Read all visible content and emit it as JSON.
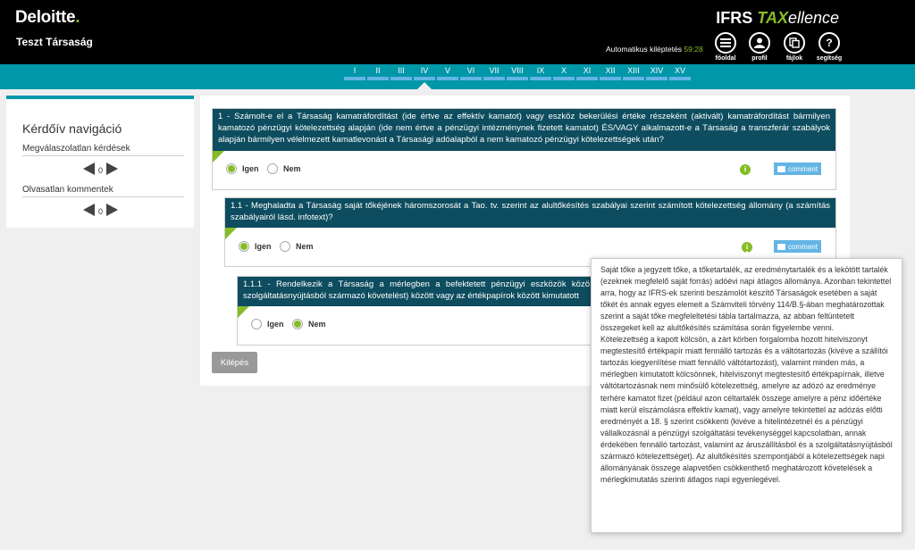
{
  "header": {
    "logo": "Deloitte",
    "logo_dot": ".",
    "company": "Teszt Társaság",
    "brand_ifrs": "IFRS ",
    "brand_tax": "TAX",
    "brand_ellence": "ellence",
    "logout_label": "Automatikus kiléptetés",
    "logout_time": "59:28",
    "buttons": [
      {
        "label": "főoldal",
        "icon": "menu-icon"
      },
      {
        "label": "profil",
        "icon": "user-icon"
      },
      {
        "label": "fájlok",
        "icon": "files-icon"
      },
      {
        "label": "segítség",
        "icon": "help-icon"
      }
    ]
  },
  "roman_nav": [
    "I",
    "II",
    "III",
    "IV",
    "V",
    "VI",
    "VII",
    "VIII",
    "IX",
    "X",
    "XI",
    "XII",
    "XIII",
    "XIV",
    "XV"
  ],
  "active_roman": "IV",
  "sidebar": {
    "title": "Kérdőív navigáció",
    "unanswered_label": "Megválaszolatlan kérdések",
    "unanswered_count": "0",
    "unread_label": "Olvasatlan kommentek",
    "unread_count": "0"
  },
  "questions": [
    {
      "text": "1 - Számolt-e el a Társaság kamatráfordítást (ide értve az effektív kamatot) vagy eszköz bekerülési értéke részeként (aktivált) kamatráfordítást bármilyen kamatozó pénzügyi kötelezettség alapján (ide nem értve a pénzügyi intézménynek fizetett kamatot) ÉS/VAGY alkalmazott-e a Társaság a transzferár szabályok alapján bármilyen vélelmezett kamatlevonást a Társasági adóalapból a nem kamatozó pénzügyi kötelezettségek után?",
      "yes": "Igen",
      "no": "Nem",
      "selected": "yes",
      "comment": "comment"
    },
    {
      "text": "1.1 - Meghaladta a Társaság saját tőkéjének háromszorosát a Tao. tv. szerint az alultőkésítés szabályai szerint számított kötelezettség állomány (a számítás szabályairól lásd. infotext)?",
      "yes": "Igen",
      "no": "Nem",
      "selected": "yes",
      "comment": "comment"
    },
    {
      "text": "1.1.1 - Rendelkezik a Társaság a mérlegben a befektetett pénzügyi eszközök közö szolgáltatásnyújtásból származó követelést) között vagy az értékpapírok között kimutatott",
      "yes": "Igen",
      "no": "Nem",
      "selected": "no"
    }
  ],
  "logout_button": "Kilépés",
  "tooltip": {
    "paragraphs": [
      "Saját tőke a jegyzett tőke, a tőketartalék, az eredménytartalék és a lekötött tartalék (ezeknek megfelelő saját forrás) adóévi napi átlagos állománya. Azonban tekintettel arra, hogy az IFRS-ek szerinti beszámolót készítő Társaságok esetében a saját tőkét és annak egyes elemeit a Számviteli törvény 114/B.§-ában meghatározottak szerint a saját tőke megfeleltetési tábla tartalmazza, az abban feltüntetett összegeket kell az alultőkésítés számítása során figyelembe venni.",
      "Kötelezettség a kapott kölcsön, a zárt körben forgalomba hozott hitelviszonyt megtestesítő értékpapír miatt fennálló tartozás és a váltótartozás (kivéve a szállítói tartozás kiegyenlítése miatt fennálló váltótartozást), valamint minden más, a mérlegben kimutatott kölcsönnek, hitelviszonyt megtestesítő értékpapírnak, illetve váltótartozásnak nem minősülő kötelezettség, amelyre az adózó az eredménye terhére kamatot fizet (például azon céltartalék összege amelyre a pénz időértéke miatt kerül elszámolásra effektív kamat), vagy amelyre tekintettel az adózás előtti eredményét a 18. § szerint csökkenti (kivéve a hitelintézetnél és a pénzügyi vállalkozásnál a pénzügyi szolgáltatási tevékenységgel kapcsolatban, annak érdekében fennálló tartozást, valamint az áruszállításból és a szolgáltatásnyújtásból származó kötelezettséget). Az alultőkésítés szempontjából a kötelezettségek napi állományának összege alapvetően csökkenthető meghatározott követelések a mérlegkimutatás szerinti átlagos napi egyenlegével."
    ]
  },
  "colors": {
    "header_bg": "#000000",
    "accent_green": "#86bc25",
    "teal": "#0097a9",
    "question_header": "#0d4d5f",
    "comment_blue": "#62b5e5"
  }
}
